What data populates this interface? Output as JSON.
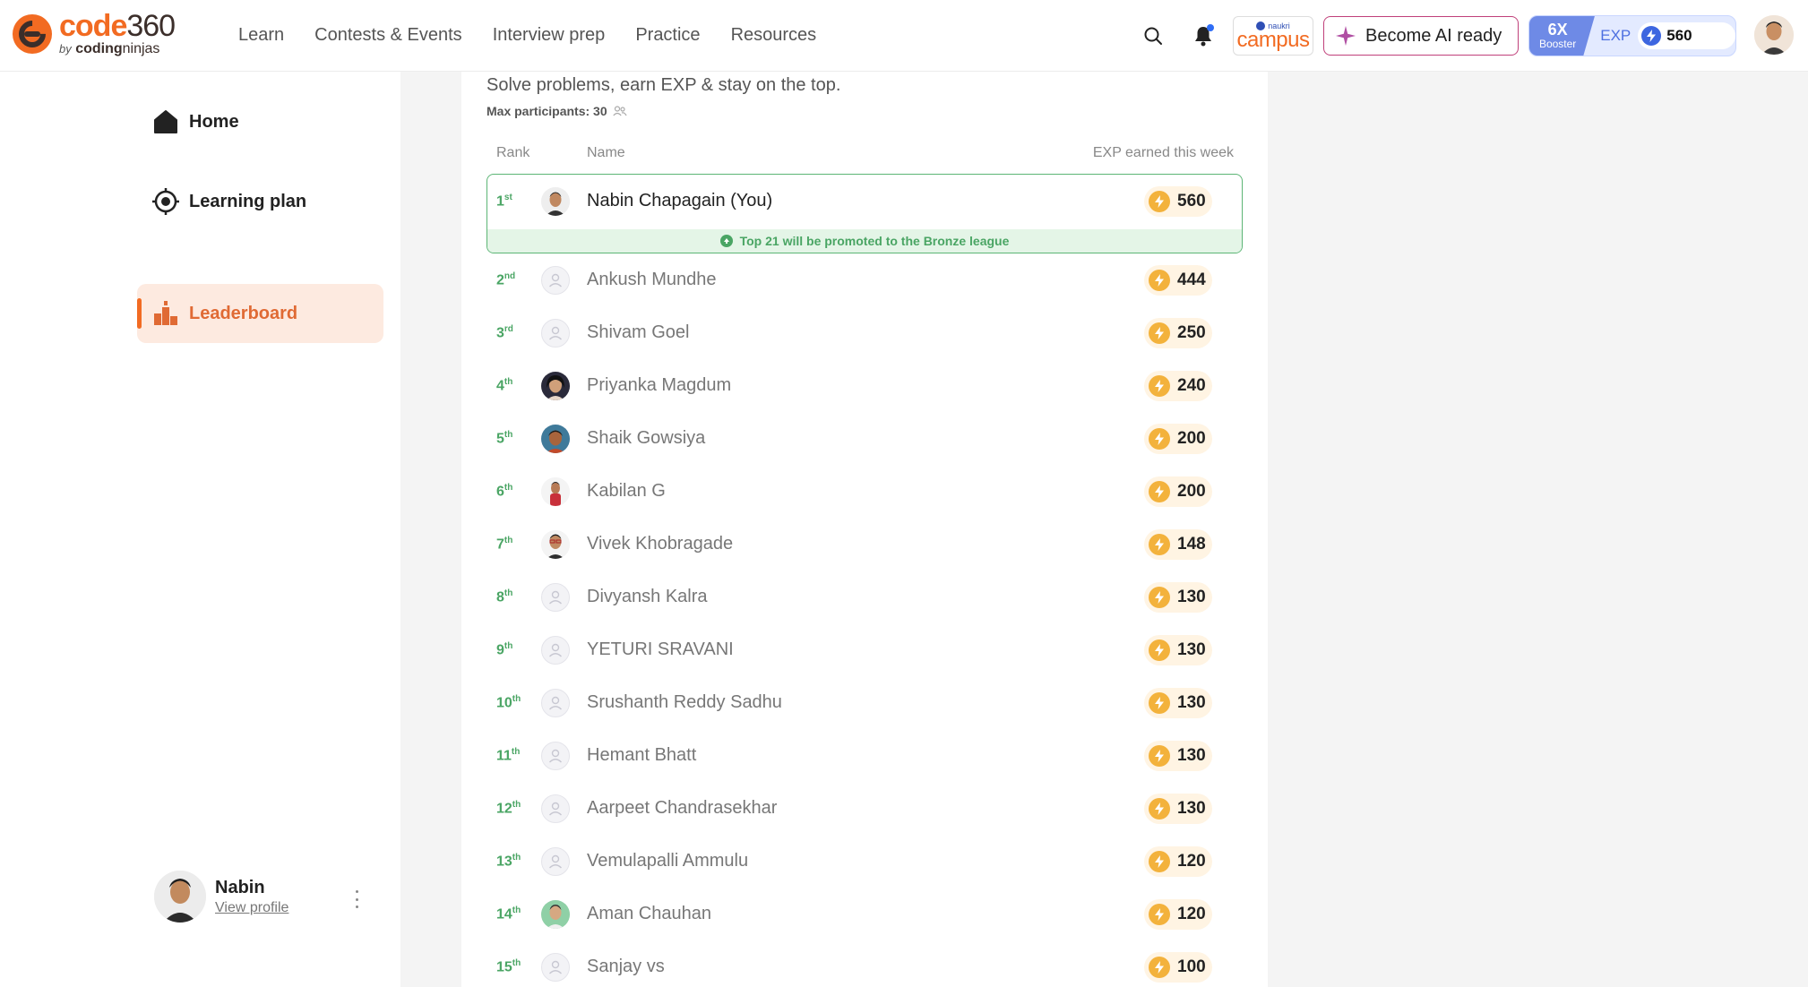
{
  "header": {
    "logo_main_a": "code",
    "logo_main_b": "360",
    "logo_sub_by": "by",
    "logo_sub_a": "coding",
    "logo_sub_b": "ninjas",
    "nav": [
      "Learn",
      "Contests & Events",
      "Interview prep",
      "Practice",
      "Resources"
    ],
    "campus_top": "naukri",
    "campus_main": "campus",
    "ai_button": "Become AI ready",
    "booster_multiplier": "6X",
    "booster_label": "Booster",
    "exp_label": "EXP",
    "exp_value": "560"
  },
  "sidebar": {
    "items": [
      {
        "label": "Home",
        "icon": "home-icon"
      },
      {
        "label": "Learning plan",
        "icon": "target-icon"
      },
      {
        "label": "Leaderboard",
        "icon": "podium-icon",
        "active": true
      }
    ],
    "profile": {
      "name": "Nabin",
      "link": "View profile"
    }
  },
  "leaderboard": {
    "subtitle": "Solve problems, earn EXP & stay on the top.",
    "max_participants": "Max participants: 30",
    "columns": {
      "rank": "Rank",
      "name": "Name",
      "exp": "EXP earned this week"
    },
    "promo_note": "Top 21 will be promoted to the Bronze league",
    "rows": [
      {
        "rank": "1",
        "suffix": "st",
        "name": "Nabin Chapagain (You)",
        "exp": "560",
        "avatar": "photo-male-a"
      },
      {
        "rank": "2",
        "suffix": "nd",
        "name": "Ankush Mundhe",
        "exp": "444",
        "avatar": "placeholder"
      },
      {
        "rank": "3",
        "suffix": "rd",
        "name": "Shivam Goel",
        "exp": "250",
        "avatar": "placeholder"
      },
      {
        "rank": "4",
        "suffix": "th",
        "name": "Priyanka Magdum",
        "exp": "240",
        "avatar": "photo-female"
      },
      {
        "rank": "5",
        "suffix": "th",
        "name": "Shaik Gowsiya",
        "exp": "200",
        "avatar": "photo-female-b"
      },
      {
        "rank": "6",
        "suffix": "th",
        "name": "Kabilan G",
        "exp": "200",
        "avatar": "photo-male-red"
      },
      {
        "rank": "7",
        "suffix": "th",
        "name": "Vivek Khobragade",
        "exp": "148",
        "avatar": "photo-male-glasses"
      },
      {
        "rank": "8",
        "suffix": "th",
        "name": "Divyansh Kalra",
        "exp": "130",
        "avatar": "placeholder"
      },
      {
        "rank": "9",
        "suffix": "th",
        "name": "YETURI SRAVANI",
        "exp": "130",
        "avatar": "placeholder"
      },
      {
        "rank": "10",
        "suffix": "th",
        "name": "Srushanth Reddy Sadhu",
        "exp": "130",
        "avatar": "placeholder"
      },
      {
        "rank": "11",
        "suffix": "th",
        "name": "Hemant Bhatt",
        "exp": "130",
        "avatar": "placeholder"
      },
      {
        "rank": "12",
        "suffix": "th",
        "name": "Aarpeet Chandrasekhar",
        "exp": "130",
        "avatar": "placeholder"
      },
      {
        "rank": "13",
        "suffix": "th",
        "name": "Vemulapalli Ammulu",
        "exp": "120",
        "avatar": "placeholder"
      },
      {
        "rank": "14",
        "suffix": "th",
        "name": "Aman Chauhan",
        "exp": "120",
        "avatar": "photo-male-green"
      },
      {
        "rank": "15",
        "suffix": "th",
        "name": "Sanjay vs",
        "exp": "100",
        "avatar": "placeholder"
      }
    ]
  },
  "colors": {
    "brand_orange": "#f26b22",
    "rank_green": "#4aa564",
    "exp_gold": "#f3b23c",
    "booster_blue": "#6e8ae6"
  }
}
